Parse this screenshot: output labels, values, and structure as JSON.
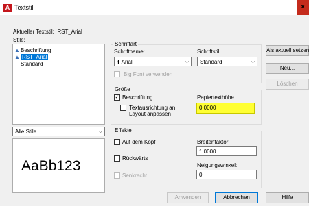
{
  "window": {
    "title": "Textstil",
    "app_icon": "A",
    "close_glyph": "×"
  },
  "current_style": {
    "label": "Aktueller Textstil:",
    "value": "RST_Arial"
  },
  "styles": {
    "label": "Stile:",
    "items": [
      {
        "icon": "annotative-icon",
        "glyph": "▲",
        "label": "Beschriftung"
      },
      {
        "icon": "annotative-icon",
        "glyph": "▲",
        "label": "RST_Arial",
        "selected": true
      },
      {
        "icon": "",
        "glyph": "",
        "label": "Standard"
      }
    ],
    "filter": "Alle Stile"
  },
  "preview": {
    "text": "AaBb123"
  },
  "font": {
    "group_title": "Schriftart",
    "name_label": "Schriftname:",
    "name_value": "Arial",
    "name_icon": "truetype-icon",
    "name_glyph": "Ŧ",
    "style_label": "Schriftstil:",
    "style_value": "Standard",
    "bigfont_label": "Big Font verwenden"
  },
  "size": {
    "group_title": "Größe",
    "annotative_label": "Beschriftung",
    "annotative_checked": true,
    "match_orientation_label_1": "Textausrichtung an",
    "match_orientation_label_2": "Layout anpassen",
    "paper_height_label": "Papiertexthöhe",
    "paper_height_value": "0.0000"
  },
  "effects": {
    "group_title": "Effekte",
    "upside_down_label": "Auf dem Kopf",
    "backwards_label": "Rückwärts",
    "vertical_label": "Senkrecht",
    "width_factor_label": "Breitenfaktor:",
    "width_factor_value": "1.0000",
    "oblique_label": "Neigungswinkel:",
    "oblique_value": "0"
  },
  "buttons": {
    "set_current": "Als aktuell setzen",
    "new": "Neu...",
    "delete": "Löschen",
    "apply": "Anwenden",
    "cancel": "Abbrechen",
    "help": "Hilfe"
  },
  "colors": {
    "highlight": "#ffff33",
    "selection": "#0078d7",
    "close": "#c42b1c",
    "app_icon": "#c4161c"
  }
}
